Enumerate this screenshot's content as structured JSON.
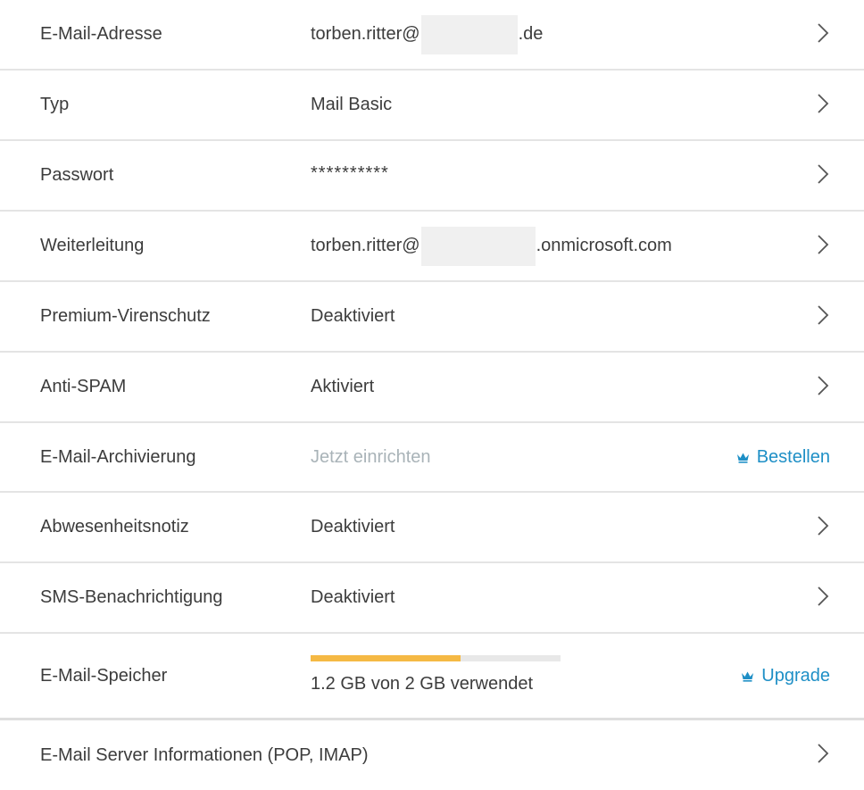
{
  "rows": {
    "email": {
      "label": "E-Mail-Adresse",
      "value_prefix": "torben.ritter@",
      "value_suffix": ".de"
    },
    "type": {
      "label": "Typ",
      "value": "Mail Basic"
    },
    "password": {
      "label": "Passwort",
      "value": "**********"
    },
    "forwarding": {
      "label": "Weiterleitung",
      "value_prefix": "torben.ritter@",
      "value_suffix": ".onmicrosoft.com"
    },
    "antivirus": {
      "label": "Premium-Virenschutz",
      "value": "Deaktiviert"
    },
    "antispam": {
      "label": "Anti-SPAM",
      "value": "Aktiviert"
    },
    "archiving": {
      "label": "E-Mail-Archivierung",
      "value": "Jetzt einrichten",
      "action": "Bestellen"
    },
    "autoreply": {
      "label": "Abwesenheitsnotiz",
      "value": "Deaktiviert"
    },
    "sms": {
      "label": "SMS-Benachrichtigung",
      "value": "Deaktiviert"
    },
    "storage": {
      "label": "E-Mail-Speicher",
      "usage_text": "1.2 GB von 2 GB verwendet",
      "used_fraction": 0.6,
      "action": "Upgrade"
    },
    "server": {
      "label": "E-Mail Server Informationen (POP, IMAP)"
    }
  },
  "icons": {
    "chevron": "chevron-right-icon",
    "crown": "crown-icon"
  },
  "colors": {
    "accent": "#1e8fc6",
    "progress": "#f5b944",
    "placeholder": "#a9b3b8",
    "divider": "#e4e4e4"
  }
}
